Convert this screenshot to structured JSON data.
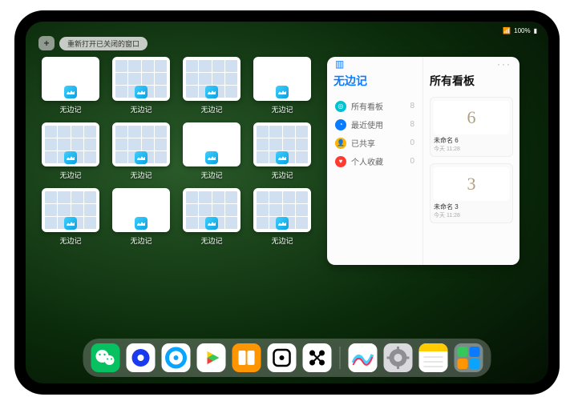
{
  "status": {
    "battery": "100%",
    "signal": "●●●●"
  },
  "topbar": {
    "plus": "+",
    "reopen_label": "重新打开已关闭的窗口"
  },
  "app_name": "无边记",
  "thumbs": [
    {
      "label": "无边记",
      "style": "blank"
    },
    {
      "label": "无边记",
      "style": "grid"
    },
    {
      "label": "无边记",
      "style": "grid"
    },
    {
      "label": "无边记",
      "style": "blank"
    },
    {
      "label": "无边记",
      "style": "grid"
    },
    {
      "label": "无边记",
      "style": "grid"
    },
    {
      "label": "无边记",
      "style": "blank"
    },
    {
      "label": "无边记",
      "style": "grid"
    },
    {
      "label": "无边记",
      "style": "grid"
    },
    {
      "label": "无边记",
      "style": "blank"
    },
    {
      "label": "无边记",
      "style": "grid"
    },
    {
      "label": "无边记",
      "style": "grid"
    }
  ],
  "panel": {
    "left_title": "无边记",
    "right_title": "所有看板",
    "categories": [
      {
        "icon_name": "grid-icon",
        "color": "#00c2d0",
        "label": "所有看板",
        "count": 8
      },
      {
        "icon_name": "clock-icon",
        "color": "#0a7aff",
        "label": "最近使用",
        "count": 8
      },
      {
        "icon_name": "share-icon",
        "color": "#ffb300",
        "label": "已共享",
        "count": 0
      },
      {
        "icon_name": "heart-icon",
        "color": "#ff3b30",
        "label": "个人收藏",
        "count": 0
      }
    ],
    "boards": [
      {
        "glyph": "6",
        "name": "未命名 6",
        "date": "今天 11:28"
      },
      {
        "glyph": "3",
        "name": "未命名 3",
        "date": "今天 11:28"
      }
    ]
  },
  "dock": {
    "apps": [
      {
        "name": "wechat",
        "bg": "#07c160",
        "glyph_color": "#fff"
      },
      {
        "name": "browser1",
        "bg": "#ffffff",
        "glyph_color": "#1a3af2"
      },
      {
        "name": "browser2",
        "bg": "#ffffff",
        "glyph_color": "#0aa4ff"
      },
      {
        "name": "play",
        "bg": "#ffffff",
        "glyph_color": "#ffcc00"
      },
      {
        "name": "books",
        "bg": "#ff9500",
        "glyph_color": "#fff"
      },
      {
        "name": "dice",
        "bg": "#ffffff",
        "glyph_color": "#000"
      },
      {
        "name": "nodes",
        "bg": "#ffffff",
        "glyph_color": "#000"
      }
    ],
    "recents": [
      {
        "name": "freeform",
        "bg": "#ffffff"
      },
      {
        "name": "settings",
        "bg": "#d9d9de"
      },
      {
        "name": "notes",
        "bg": "#ffffff"
      }
    ]
  }
}
